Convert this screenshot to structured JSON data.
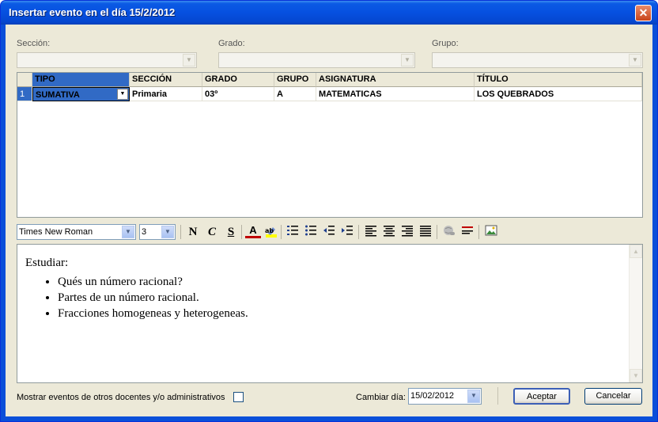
{
  "window": {
    "title": "Insertar evento en el día 15/2/2012",
    "close_glyph": "✕"
  },
  "filters": {
    "seccion_label": "Sección:",
    "grado_label": "Grado:",
    "grupo_label": "Grupo:"
  },
  "grid": {
    "columns": [
      "TIPO",
      "SECCIÓN",
      "GRADO",
      "GRUPO",
      "ASIGNATURA",
      "TÍTULO"
    ],
    "rows": [
      {
        "num": "1",
        "tipo": "SUMATIVA",
        "seccion": "Primaria",
        "grado": "03º",
        "grupo": "A",
        "asignatura": "MATEMATICAS",
        "titulo": "LOS QUEBRADOS"
      }
    ]
  },
  "toolbar": {
    "font_name": "Times New Roman",
    "font_size": "3",
    "bold_label": "N",
    "italic_label": "C",
    "strike_label": "S",
    "font_color_label": "A"
  },
  "editor": {
    "heading": "Estudiar:",
    "bullets": [
      "Qués un número racional?",
      "Partes de un número racional.",
      "Fracciones homogeneas y heterogeneas."
    ]
  },
  "footer": {
    "show_others_label": "Mostrar eventos de otros docentes y/o administrativos",
    "change_day_label": "Cambiar día:",
    "date_value": "15/02/2012",
    "accept_label": "Aceptar",
    "cancel_label": "Cancelar"
  },
  "colors": {
    "title_bar": "#0650e0",
    "selection": "#316ac5",
    "dialog_bg": "#ece9d8"
  }
}
